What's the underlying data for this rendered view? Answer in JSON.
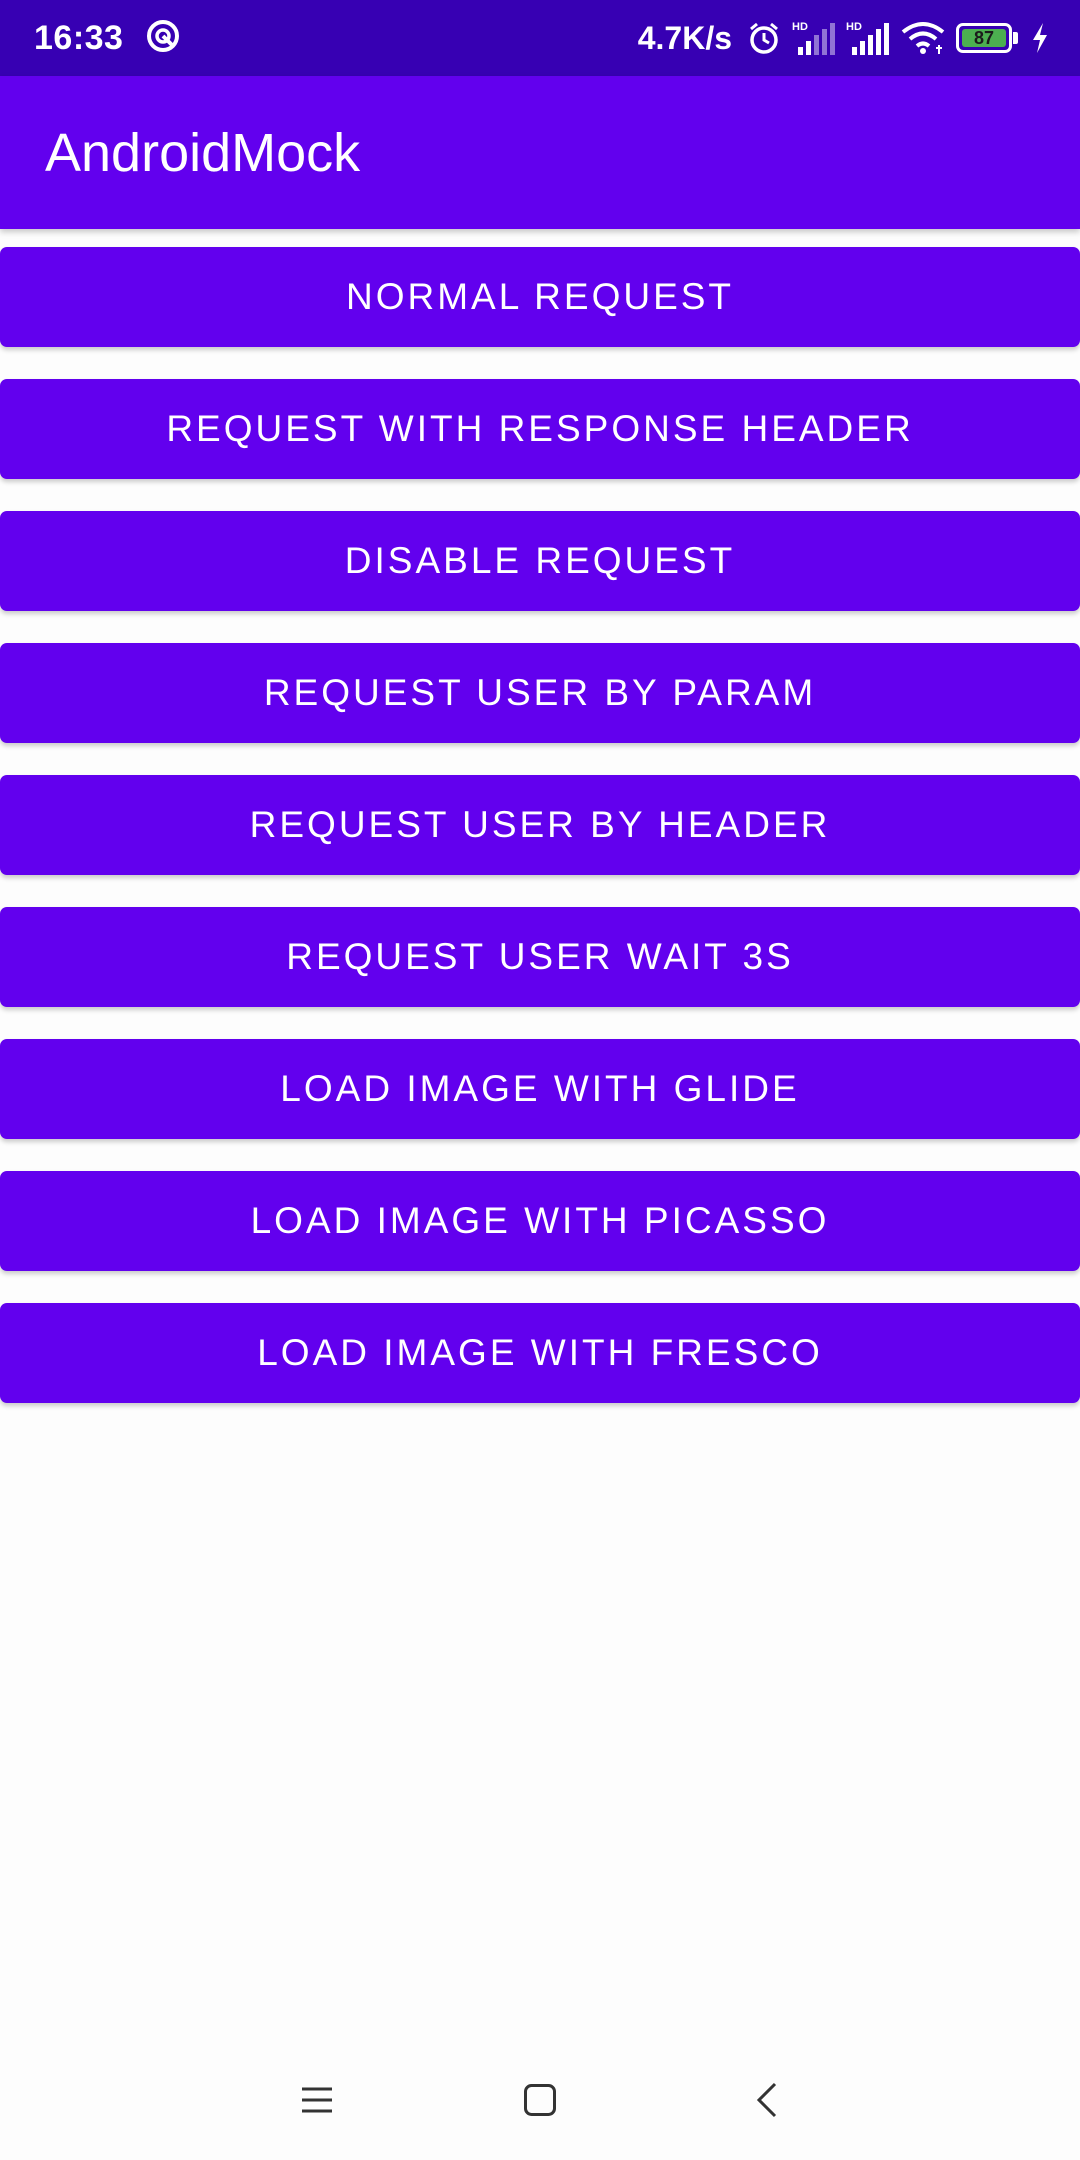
{
  "status_bar": {
    "time": "16:33",
    "net_speed": "4.7K/s",
    "battery_level": "87",
    "battery_color": "#4caf50",
    "icons": [
      "vpn-icon",
      "alarm-icon",
      "hd-signal-icon",
      "hd-signal-icon",
      "wifi-icon",
      "battery-icon",
      "charging-icon"
    ]
  },
  "app_bar": {
    "title": "AndroidMock",
    "color": "#6200ee"
  },
  "buttons": [
    "NORMAL REQUEST",
    "REQUEST WITH RESPONSE HEADER",
    "DISABLE REQUEST",
    "REQUEST USER BY PARAM",
    "REQUEST USER BY HEADER",
    "REQUEST USER WAIT 3S",
    "LOAD IMAGE WITH GLIDE",
    "LOAD IMAGE WITH PICASSO",
    "LOAD IMAGE WITH FRESCO"
  ],
  "nav_bar": {
    "icons": [
      "menu-icon",
      "home-icon",
      "back-icon"
    ]
  }
}
